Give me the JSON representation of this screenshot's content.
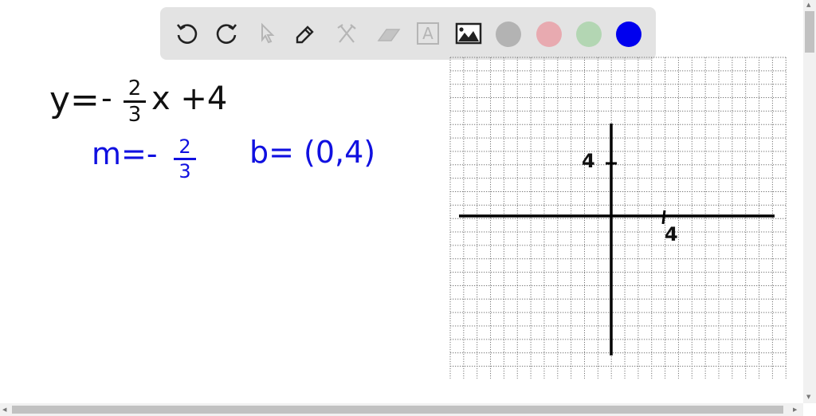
{
  "toolbar": {
    "tools": [
      {
        "name": "undo-icon",
        "enabled": true
      },
      {
        "name": "redo-icon",
        "enabled": true
      },
      {
        "name": "select-pointer-icon",
        "enabled": false
      },
      {
        "name": "pen-icon",
        "enabled": true
      },
      {
        "name": "tools-icon",
        "enabled": false
      },
      {
        "name": "eraser-icon",
        "enabled": false
      },
      {
        "name": "text-icon",
        "enabled": false,
        "label": "A"
      },
      {
        "name": "image-icon",
        "enabled": true
      }
    ],
    "colors": [
      "#b3b3b3",
      "#e8aab0",
      "#b3d6b3",
      "#0000ee"
    ],
    "selected_color": "#0000ee"
  },
  "canvas": {
    "equation": {
      "lhs": "y=",
      "sign": "-",
      "num": "2",
      "den": "3",
      "rest": "x +4",
      "color": "#111111"
    },
    "slope": {
      "lhs": "m=-",
      "num": "2",
      "den": "3",
      "color": "#1010e0"
    },
    "intercept": {
      "text": "b= (0,4)",
      "color": "#1010e0"
    },
    "graph": {
      "y_tick_label": "4",
      "x_tick_label": "4"
    }
  }
}
